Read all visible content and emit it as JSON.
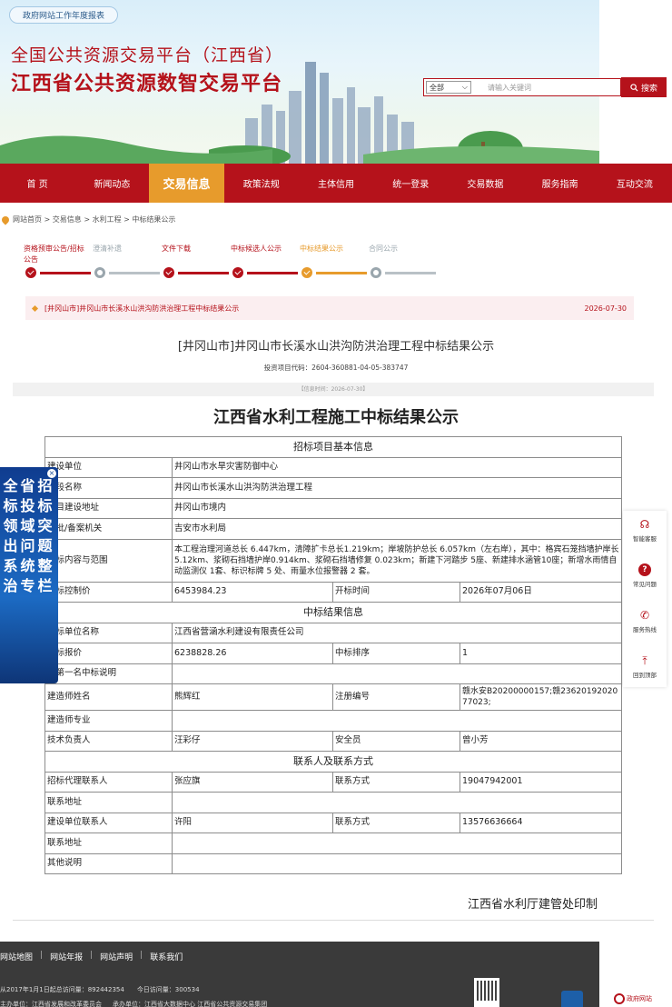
{
  "header": {
    "report_tag": "政府网站工作年度报表",
    "title_line1": "全国公共资源交易平台（江西省）",
    "title_line2": "江西省公共资源数智交易平台",
    "search_scope": "全部",
    "search_placeholder": "请输入关键词",
    "search_button": "搜索"
  },
  "nav": {
    "items": [
      {
        "label": "首 页"
      },
      {
        "label": "新闻动态"
      },
      {
        "label": "交易信息"
      },
      {
        "label": "政策法规"
      },
      {
        "label": "主体信用"
      },
      {
        "label": "统一登录"
      },
      {
        "label": "交易数据"
      },
      {
        "label": "服务指南"
      },
      {
        "label": "互动交流"
      }
    ],
    "active_index": 2
  },
  "breadcrumb": "网站首页 > 交易信息 > 水利工程 > 中标结果公示",
  "steps": [
    {
      "label_line1": "资格预审公告/招标",
      "label_line2": "公告",
      "state": "done"
    },
    {
      "label_line1": "澄清补遗",
      "label_line2": "",
      "state": "todo"
    },
    {
      "label_line1": "文件下载",
      "label_line2": "",
      "state": "done"
    },
    {
      "label_line1": "中标候选人公示",
      "label_line2": "",
      "state": "done"
    },
    {
      "label_line1": "中标结果公示",
      "label_line2": "",
      "state": "current"
    },
    {
      "label_line1": "合同公示",
      "label_line2": "",
      "state": "todo"
    }
  ],
  "notice": {
    "text": "[井冈山市]井冈山市长溪水山洪沟防洪治理工程中标结果公示",
    "date": "2026-07-30"
  },
  "document": {
    "title": "[井冈山市]井冈山市长溪水山洪沟防洪治理工程中标结果公示",
    "project_code": "投资项目代码：2604-360881-04-05-383747",
    "info_time": "【信息时间：2026-07-30】",
    "main_title": "江西省水利工程施工中标结果公示",
    "sections": {
      "basic": "招标项目基本信息",
      "result": "中标结果信息",
      "contact": "联系人及联系方式"
    },
    "rows": {
      "builder": {
        "label": "建设单位",
        "value": "井冈山市水旱灾害防御中心"
      },
      "project": {
        "label": "标段名称",
        "value": "井冈山市长溪水山洪沟防洪治理工程"
      },
      "location": {
        "label": "项目建设地址",
        "value": "井冈山市境内"
      },
      "approver": {
        "label": "审批/备案机关",
        "value": "吉安市水利局"
      },
      "scope": {
        "label": "招标内容与范围",
        "value": "本工程治理河道总长 6.447km，清障扩卡总长1.219km；岸坡防护总长 6.057km（左右岸），其中：格宾石笼挡墙护岸长 5.12km、浆砌石挡墙护岸0.914km、浆砌石挡墙修复 0.023km；新建下河踏步 5座、新建排水涵管10座；新增水雨情自动监测仪 1套、标识标牌 5 处、雨量水位报警器 2 套。"
      },
      "control_price": {
        "label": "招标控制价",
        "value": "6453984.23",
        "label2": "开标时间",
        "value2": "2026年07月06日"
      },
      "winner": {
        "label": "中标单位名称",
        "value": "江西省营涵水利建设有限责任公司"
      },
      "bid_price": {
        "label": "中标报价",
        "value": "6238828.26",
        "label2": "中标排序",
        "value2": "1"
      },
      "non_first": {
        "label": "非第一名中标说明",
        "value": ""
      },
      "engineer": {
        "label": "建造师姓名",
        "value": "熊辉红",
        "label2": "注册编号",
        "value2": "赣水安B20200000157;赣2362019202077023;"
      },
      "engineer_major": {
        "label": "建造师专业",
        "value": ""
      },
      "tech_lead": {
        "label": "技术负责人",
        "value": "汪彩仔",
        "label2": "安全员",
        "value2": "曾小芳"
      },
      "agent_contact": {
        "label": "招标代理联系人",
        "value": "张应旗",
        "label2": "联系方式",
        "value2": "19047942001"
      },
      "agent_address": {
        "label": "联系地址",
        "value": ""
      },
      "owner_contact": {
        "label": "建设单位联系人",
        "value": "许阳",
        "label2": "联系方式",
        "value2": "13576636664"
      },
      "owner_address": {
        "label": "联系地址",
        "value": ""
      },
      "other": {
        "label": "其他说明",
        "value": ""
      }
    },
    "signature": "江西省水利厅建管处印制"
  },
  "footer": {
    "links": [
      "网站地图",
      "网站年报",
      "网站声明",
      "联系我们"
    ],
    "stat_total": "从2017年1月1日起总访问量：892442354",
    "stat_today": "今日访问量：300534",
    "org_host": "主办单位：江西省发展和改革委员会",
    "org_operator": "承办单位：江西省大数据中心  江西省公共资源交易集团",
    "gov_logo_text": "政府网站"
  },
  "float_left": {
    "text": "全省招标投标领域突出问题系统整治专栏"
  },
  "float_right": {
    "items": [
      {
        "label": "智能客服"
      },
      {
        "label": "常见问题"
      },
      {
        "label": "服务热线"
      },
      {
        "label": "回到顶部"
      }
    ]
  },
  "colors": {
    "brand_red": "#b5121b",
    "accent_orange": "#e79b2c",
    "pending_gray": "#9aa6ad"
  }
}
